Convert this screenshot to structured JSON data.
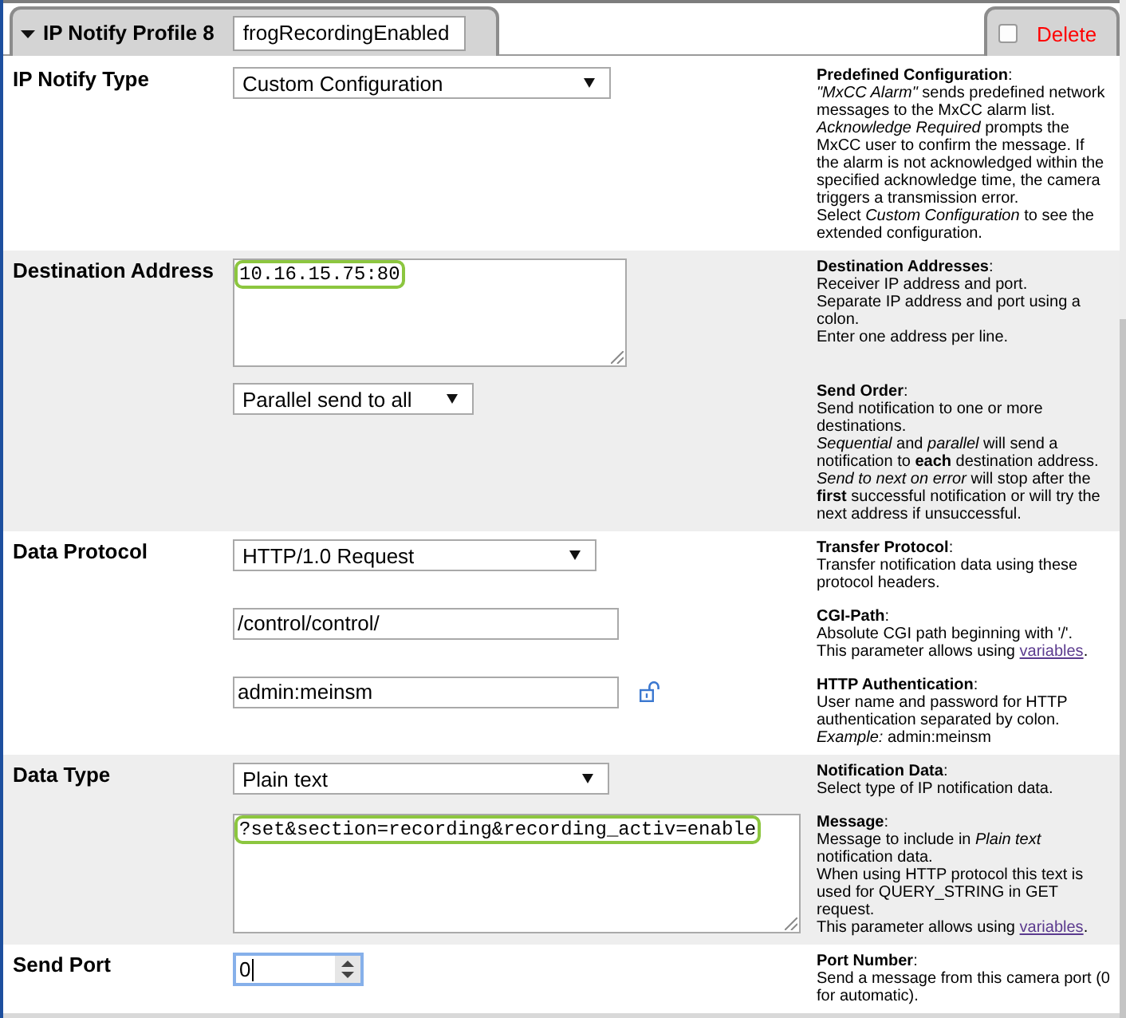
{
  "profile_tab": {
    "label": "IP Notify Profile 8",
    "expanded": true,
    "name": "frogRecordingEnabled"
  },
  "delete_tab": {
    "label": "Delete",
    "checked": false
  },
  "sections": [
    {
      "label": "IP Notify Type",
      "items": [
        {
          "control": {
            "kind": "select",
            "value": "Custom Configuration",
            "focused": false,
            "highlighted": false
          },
          "help": {
            "title": "**Predefined Configuration**:",
            "paragraphs": [
              {
                "text": "*\"MxCC Alarm\"* sends predefined network messages to the MxCC alarm list."
              },
              {
                "text": "*Acknowledge Required* prompts the MxCC user to confirm the message. If the alarm is not acknowledged within the specified acknowledge time, the camera triggers a transmission error."
              },
              {
                "text": "Select *Custom Configuration* to see the extended configuration."
              }
            ]
          }
        }
      ]
    },
    {
      "label": "Destination Address",
      "items": [
        {
          "control": {
            "kind": "textarea",
            "value": "10.16.15.75:80",
            "focused": false,
            "highlighted": true
          },
          "help": {
            "title": "**Destination Addresses**:",
            "paragraphs": [
              {
                "text": "Receiver IP address and port."
              },
              {
                "text": "Separate IP address and port using a colon."
              },
              {
                "text": "Enter one address per line."
              }
            ]
          }
        },
        {
          "control": {
            "kind": "select",
            "value": "Parallel send to all",
            "focused": false,
            "highlighted": false
          },
          "help": {
            "title": "**Send Order**:",
            "paragraphs": [
              {
                "text": "Send notification to one or more destinations."
              },
              {
                "text": "*Sequential* and *parallel* will send a notification to **each** destination address."
              },
              {
                "text": "*Send to next on error* will stop after the **first** successful notification or will try the next address if unsuccessful."
              }
            ]
          }
        }
      ]
    },
    {
      "label": "Data Protocol",
      "items": [
        {
          "control": {
            "kind": "select",
            "value": "HTTP/1.0 Request",
            "focused": false,
            "highlighted": false
          },
          "help": {
            "title": "**Transfer Protocol**:",
            "paragraphs": [
              {
                "text": "Transfer notification data using these protocol headers."
              }
            ]
          }
        },
        {
          "control": {
            "kind": "text",
            "value": "/control/control/",
            "focused": false,
            "highlighted": false
          },
          "help": {
            "title": "**CGI-Path**:",
            "paragraphs": [
              {
                "text": "Absolute CGI path beginning with '/'."
              },
              {
                "text": "This parameter allows using ",
                "link": "variables",
                "tail": "."
              }
            ]
          }
        },
        {
          "control": {
            "kind": "text",
            "value": "admin:meinsm",
            "focused": false,
            "highlighted": false,
            "locked": false
          },
          "help": {
            "title": "**HTTP Authentication**:",
            "paragraphs": [
              {
                "text": "User name and password for HTTP authentication separated by colon."
              },
              {
                "text": "*Example:* admin:meinsm"
              }
            ]
          }
        }
      ]
    },
    {
      "label": "Data Type",
      "items": [
        {
          "control": {
            "kind": "select",
            "value": "Plain text",
            "focused": false,
            "highlighted": false
          },
          "help": {
            "title": "**Notification Data**:",
            "paragraphs": [
              {
                "text": "Select type of IP notification data."
              }
            ]
          }
        },
        {
          "control": {
            "kind": "textarea",
            "value": "?set&section=recording&recording_activ=enable",
            "focused": false,
            "highlighted": true
          },
          "help": {
            "title": "**Message**:",
            "paragraphs": [
              {
                "text": "Message to include in *Plain text* notification data."
              },
              {
                "text": "When using HTTP protocol this text is used for QUERY_STRING in GET request."
              },
              {
                "text": "This parameter allows using ",
                "link": "variables",
                "tail": "."
              }
            ]
          }
        }
      ]
    },
    {
      "label": "Send Port",
      "items": [
        {
          "control": {
            "kind": "number",
            "value": "0",
            "focused": true,
            "highlighted": false
          },
          "help": {
            "title": "**Port Number**:",
            "paragraphs": [
              {
                "text": "Send a message from this camera port (0 for automatic)."
              }
            ]
          }
        }
      ]
    }
  ]
}
